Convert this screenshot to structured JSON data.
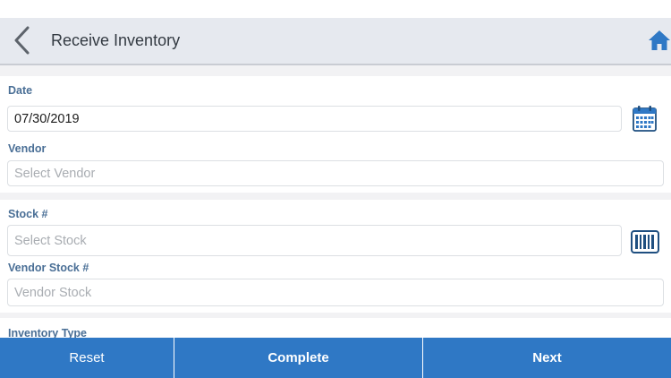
{
  "header": {
    "title": "Receive Inventory",
    "back_icon": "chevron-left-icon",
    "home_icon": "home-icon"
  },
  "form": {
    "date": {
      "label": "Date",
      "value": "07/30/2019",
      "icon": "calendar-icon"
    },
    "vendor": {
      "label": "Vendor",
      "placeholder": "Select Vendor"
    },
    "stock": {
      "label": "Stock #",
      "placeholder": "Select Stock",
      "icon": "barcode-icon"
    },
    "vendor_stock": {
      "label": "Vendor Stock #",
      "placeholder": "Vendor Stock"
    },
    "inventory_type": {
      "label": "Inventory Type"
    }
  },
  "footer": {
    "reset_label": "Reset",
    "complete_label": "Complete",
    "next_label": "Next"
  },
  "colors": {
    "accent": "#2f78c5",
    "label": "#4a6f96",
    "header_bg": "#e6e9ef",
    "icon": "#1f4f80"
  }
}
